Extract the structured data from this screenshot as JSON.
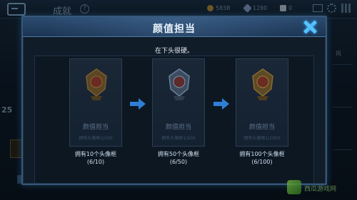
{
  "topbar": {
    "title": "成就",
    "help_icon": "?",
    "resources": [
      "5838",
      "1280",
      "0"
    ]
  },
  "left_panel": {
    "value": "25"
  },
  "right_panel": {
    "label": "风"
  },
  "dialog": {
    "title": "颜值担当",
    "subtitle": "在下头很硬。",
    "cards": [
      {
        "name": "颜值担当",
        "sub": "拥有头像框1/100"
      },
      {
        "name": "颜值担当",
        "sub": "拥有头像框1/500"
      },
      {
        "name": "颜值担当",
        "sub": "拥有头像框1/1000"
      }
    ],
    "requirements": [
      {
        "text": "拥有10个头像框",
        "progress": "(6/10)"
      },
      {
        "text": "拥有50个头像框",
        "progress": "(6/50)"
      },
      {
        "text": "拥有100个头像框",
        "progress": "(6/100)"
      }
    ]
  },
  "watermark": {
    "text": "西瓜游戏网"
  },
  "colors": {
    "accent": "#59c2ff",
    "arrow": "#2f7fd6",
    "gold": "#8a6a2e"
  }
}
